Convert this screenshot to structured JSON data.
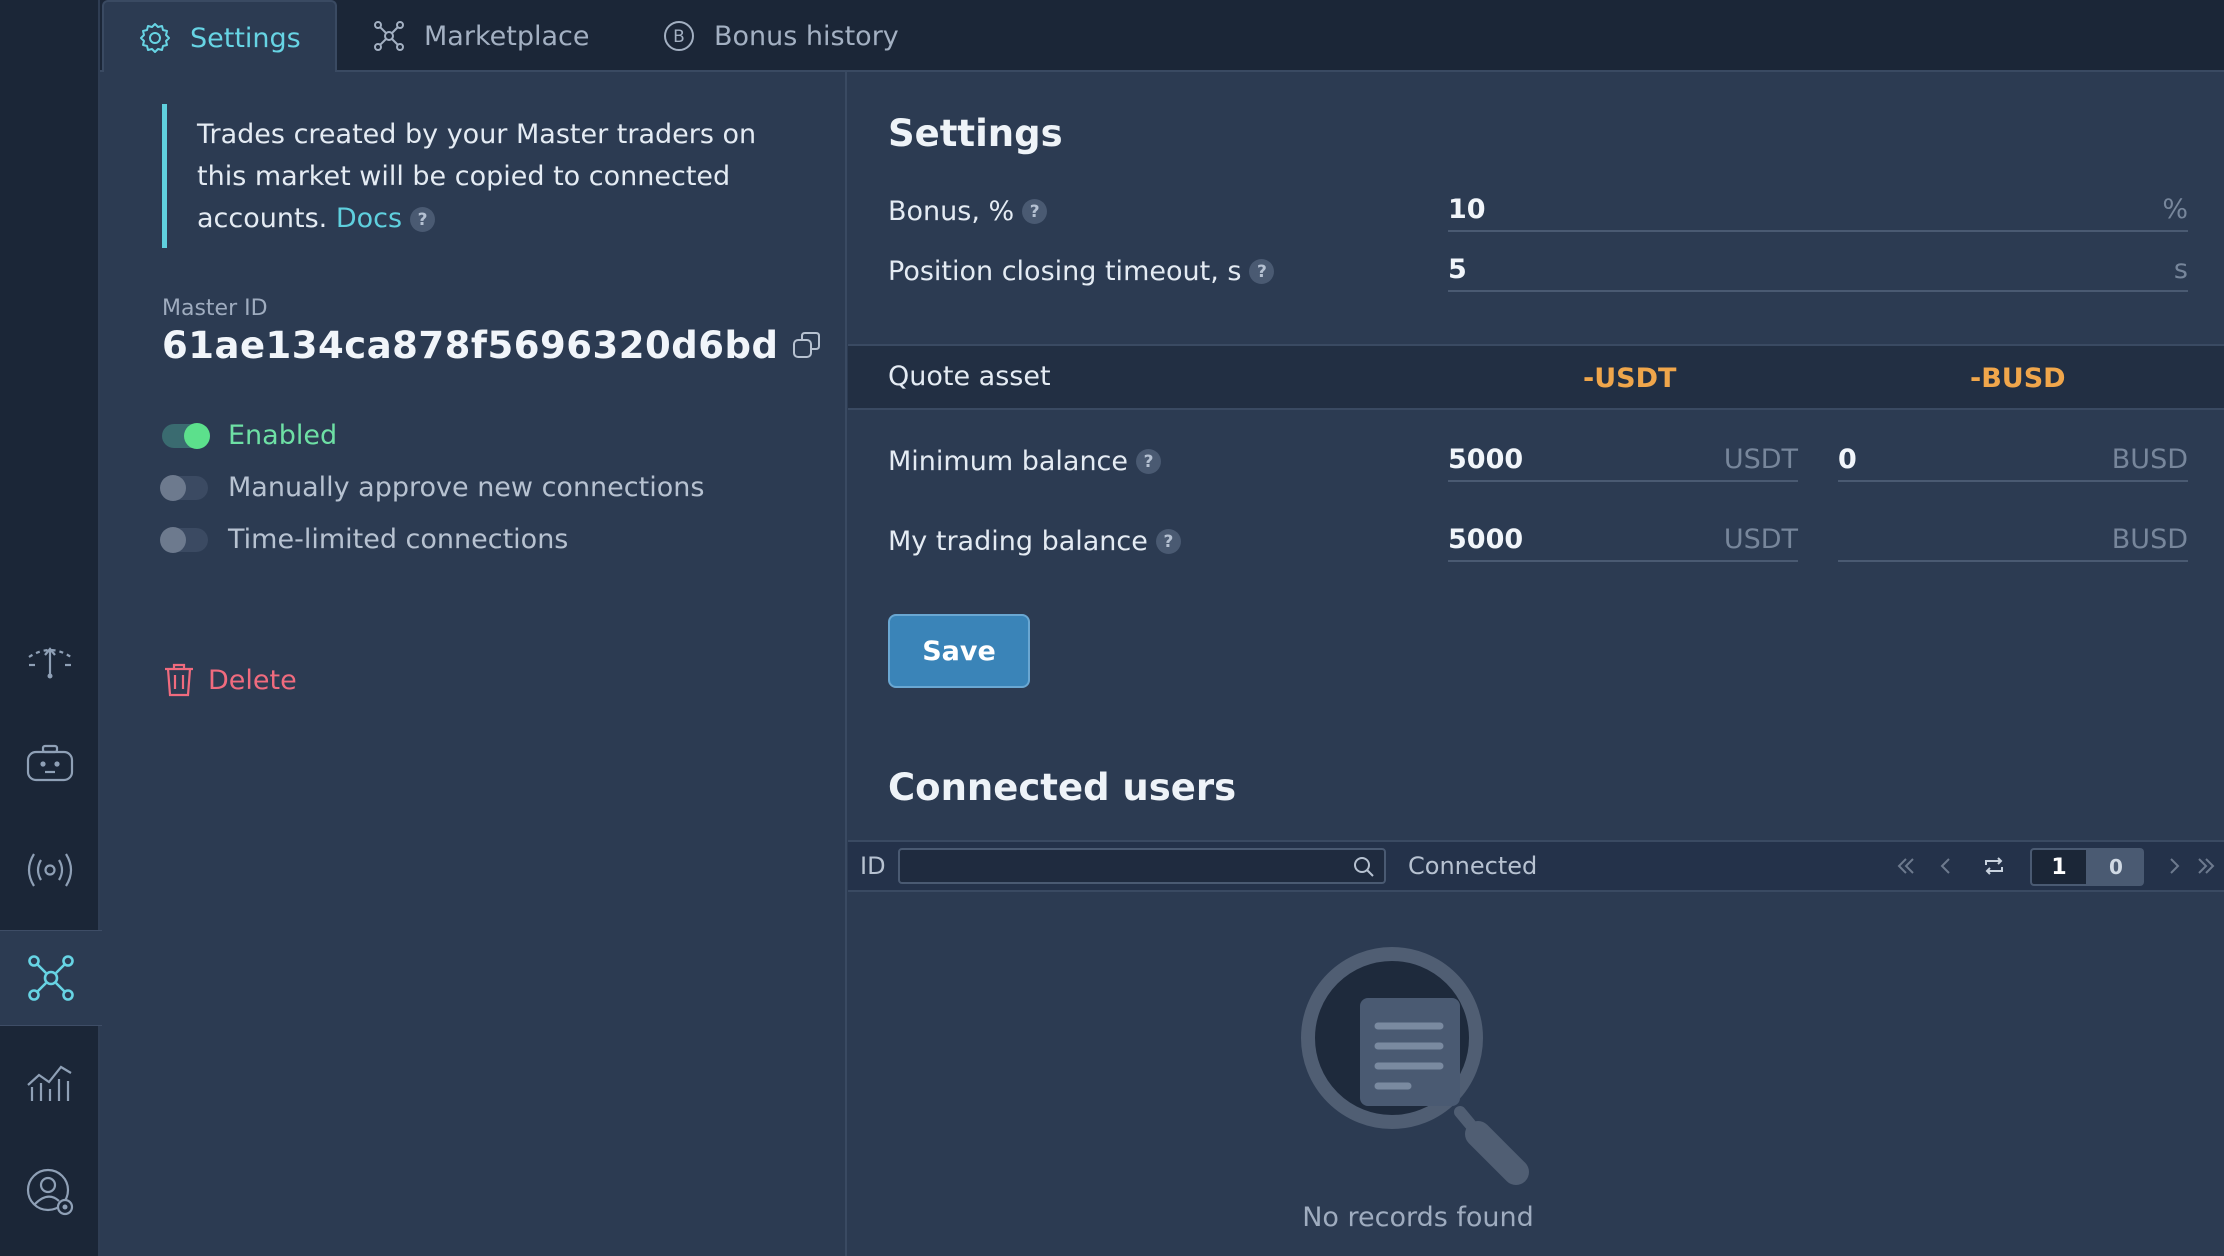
{
  "tabs": [
    {
      "label": "Settings",
      "icon": "gear-icon",
      "active": true
    },
    {
      "label": "Marketplace",
      "icon": "network-icon",
      "active": false
    },
    {
      "label": "Bonus history",
      "icon": "bitcoin-icon",
      "active": false
    }
  ],
  "rail": {
    "items": [
      "terminal-icon",
      "bot-icon",
      "signal-icon",
      "copytrading-icon",
      "analytics-icon",
      "account-settings-icon"
    ],
    "active": "copytrading-icon"
  },
  "info": {
    "text": "Trades created by your Master traders on this market will be copied to connected accounts.",
    "docs_label": "Docs"
  },
  "master": {
    "label": "Master ID",
    "id": "61ae134ca878f5696320d6bd"
  },
  "toggles": [
    {
      "label": "Enabled",
      "on": true
    },
    {
      "label": "Manually approve new connections",
      "on": false
    },
    {
      "label": "Time-limited connections",
      "on": false
    }
  ],
  "delete_label": "Delete",
  "settings": {
    "title": "Settings",
    "bonus_label": "Bonus, %",
    "bonus_value": "10",
    "bonus_unit": "%",
    "timeout_label": "Position closing timeout, s",
    "timeout_value": "5",
    "timeout_unit": "s"
  },
  "quote": {
    "label": "Quote asset",
    "asset1": "-USDT",
    "asset2": "-BUSD"
  },
  "balances": {
    "min_label": "Minimum balance",
    "min_usdt": "5000",
    "min_busd": "0",
    "my_label": "My trading balance",
    "my_usdt": "5000",
    "my_busd": "",
    "unit_usdt": "USDT",
    "unit_busd": "BUSD"
  },
  "save_label": "Save",
  "connected": {
    "title": "Connected users",
    "col_id": "ID",
    "col_connected": "Connected",
    "search_value": "",
    "page_current": "1",
    "page_total": "0",
    "empty_text": "No records found"
  },
  "colors": {
    "accent": "#5fd0de",
    "enabled": "#5ce08c",
    "asset": "#f0a64b",
    "danger": "#f06b7e",
    "primary_button": "#3a84b8"
  }
}
